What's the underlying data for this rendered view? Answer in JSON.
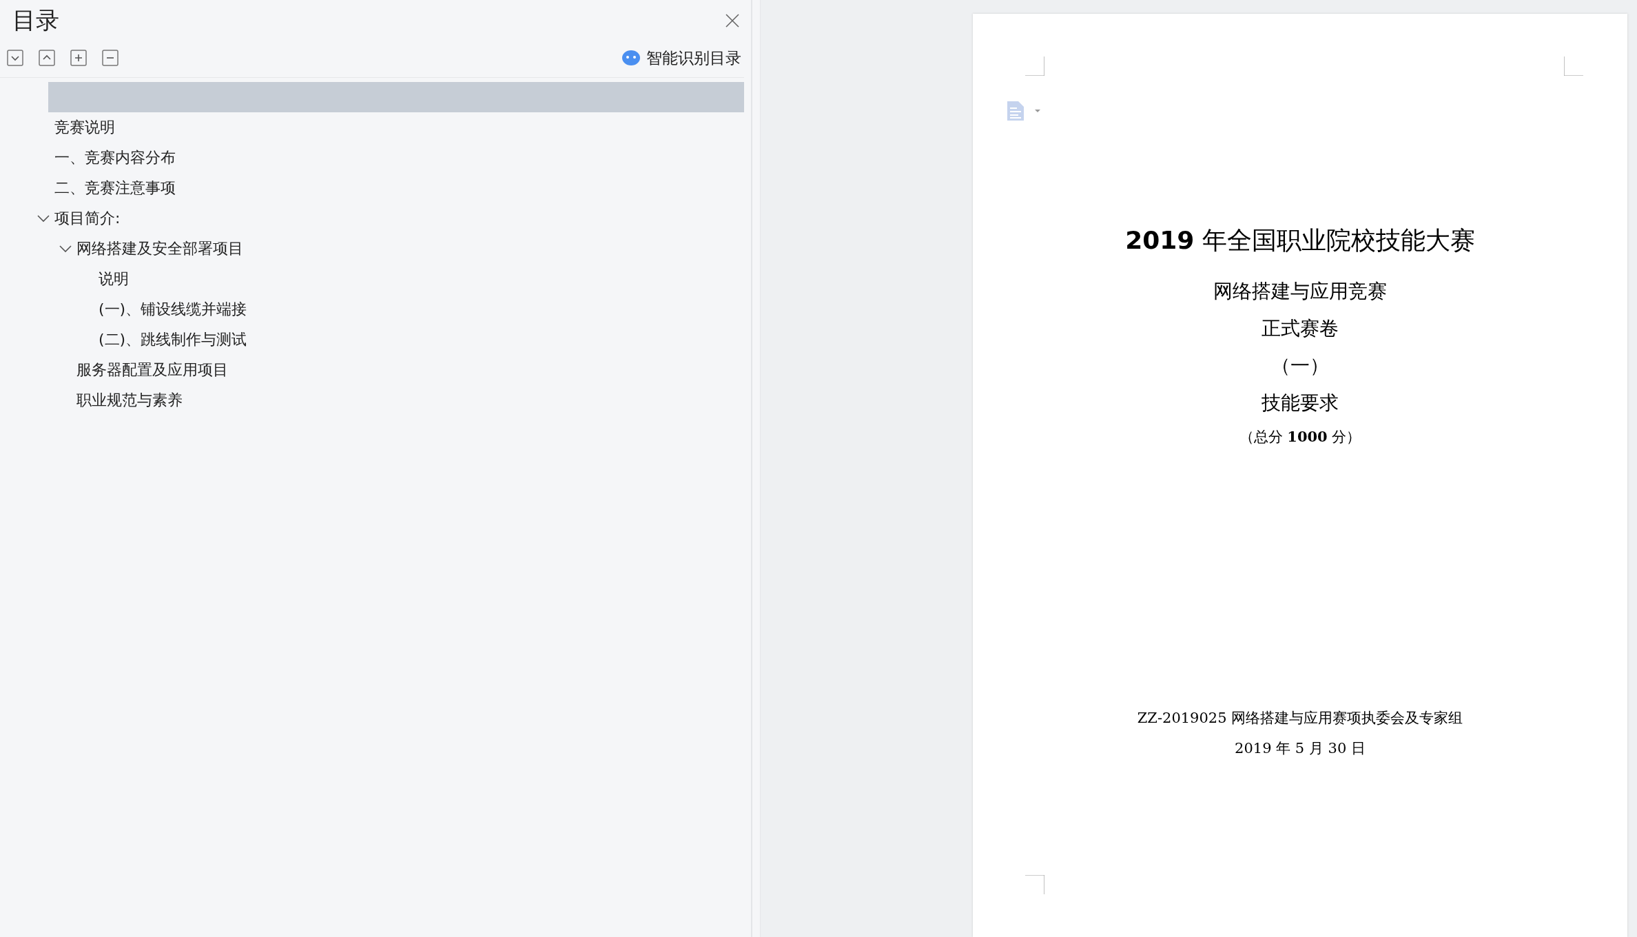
{
  "toc_panel": {
    "title": "目录",
    "smart_button": "智能识别目录",
    "highlight_row": true,
    "items": [
      {
        "label": "竞赛说明"
      },
      {
        "label": "一、竞赛内容分布"
      },
      {
        "label": "二、竞赛注意事项"
      },
      {
        "label": "项目简介:",
        "expanded": true,
        "children": [
          {
            "label": "网络搭建及安全部署项目",
            "expanded": true,
            "children": [
              {
                "label": "说明"
              },
              {
                "label": "(一)、铺设线缆并端接"
              },
              {
                "label": "(二)、跳线制作与测试"
              }
            ]
          },
          {
            "label": "服务器配置及应用项目"
          },
          {
            "label": "职业规范与素养"
          }
        ]
      }
    ]
  },
  "document": {
    "lines": [
      {
        "kind": "title",
        "text": "**2019** 年全国职业院校技能大赛"
      },
      {
        "kind": "heading",
        "text": "网络搭建与应用竞赛"
      },
      {
        "kind": "heading",
        "text": "正式赛卷"
      },
      {
        "kind": "heading",
        "text": "（一）"
      },
      {
        "kind": "heading",
        "text": "技能要求"
      },
      {
        "kind": "note",
        "text": "（总分 **1000** 分）"
      }
    ],
    "footer": [
      "ZZ-2019025 网络搭建与应用赛项执委会及专家组",
      "2019 年 5 月 30 日"
    ]
  }
}
